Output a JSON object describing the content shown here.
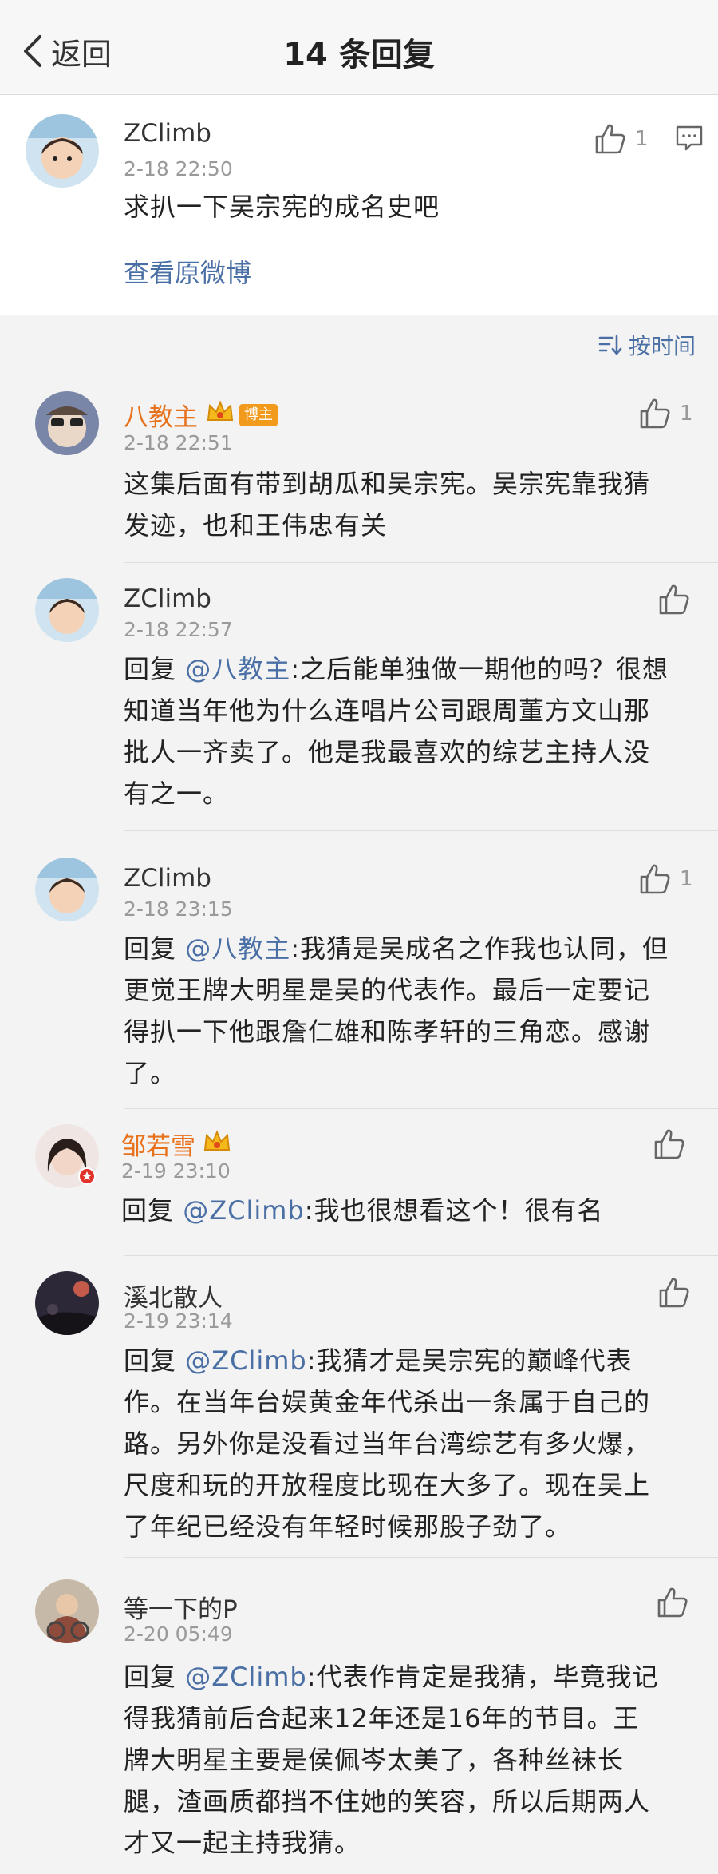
{
  "header": {
    "back_label": "返回",
    "title": "14 条回复"
  },
  "post": {
    "user": "ZClimb",
    "time": "2-18 22:50",
    "text": "求扒一下吴宗宪的成名史吧",
    "likes": "1",
    "view_original": "查看原微博"
  },
  "sort_label": "按时间",
  "badge_label": "博主",
  "replies": [
    {
      "user": "八教主",
      "time": "2-18 22:51",
      "likes": "1",
      "lines": [
        "这集后面有带到胡瓜和吴宗宪。吴宗宪靠我猜",
        "发迹，也和王伟忠有关"
      ]
    },
    {
      "user": "ZClimb",
      "time": "2-18 22:57",
      "likes": "",
      "prefix": "回复 ",
      "mention": "@八教主",
      "lines": [
        ":之后能单独做一期他的吗？很想",
        "知道当年他为什么连唱片公司跟周董方文山那",
        "批人一齐卖了。他是我最喜欢的综艺主持人没",
        "有之一。"
      ]
    },
    {
      "user": "ZClimb",
      "time": "2-18 23:15",
      "likes": "1",
      "prefix": "回复 ",
      "mention": "@八教主",
      "lines": [
        ":我猜是吴成名之作我也认同，但",
        "更觉王牌大明星是吴的代表作。最后一定要记",
        "得扒一下他跟詹仁雄和陈孝轩的三角恋。感谢",
        "了。"
      ]
    },
    {
      "user": "邹若雪",
      "time": "2-19 23:10",
      "likes": "",
      "prefix": "回复 ",
      "mention": "@ZClimb",
      "lines": [
        ":我也很想看这个！很有名"
      ]
    },
    {
      "user": "溪北散人",
      "time": "2-19 23:14",
      "likes": "",
      "prefix": "回复 ",
      "mention": "@ZClimb",
      "lines": [
        ":我猜才是吴宗宪的巅峰代表",
        "作。在当年台娱黄金年代杀出一条属于自己的",
        "路。另外你是没看过当年台湾综艺有多火爆，",
        "尺度和玩的开放程度比现在大多了。现在吴上",
        "了年纪已经没有年轻时候那股子劲了。"
      ]
    },
    {
      "user": "等一下的P",
      "time": "2-20 05:49",
      "likes": "",
      "prefix": "回复 ",
      "mention": "@ZClimb",
      "lines": [
        ":代表作肯定是我猜，毕竟我记",
        "得我猜前后合起来12年还是16年的节目。王",
        "牌大明星主要是侯佩岑太美了，各种丝袜长",
        "腿，渣画质都挡不住她的笑容，所以后期两人",
        "才又一起主持我猜。"
      ]
    }
  ],
  "colors": {
    "link": "#4a6fa5",
    "vip_name": "#e8711c",
    "badge": "#f29a1c"
  }
}
